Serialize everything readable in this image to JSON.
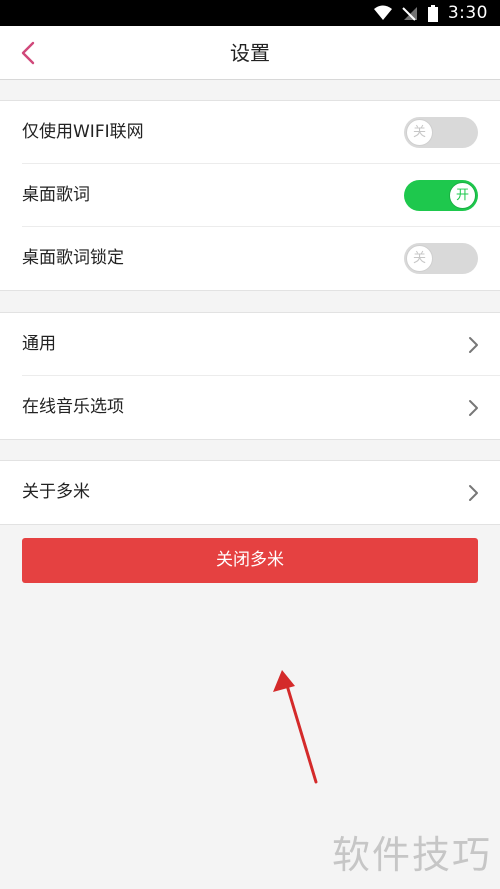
{
  "status_bar": {
    "time": "3:30",
    "icons": [
      "wifi-icon",
      "no-signal-icon",
      "battery-icon"
    ]
  },
  "nav": {
    "title": "设置",
    "back_icon": "chevron-left-icon"
  },
  "groups": [
    {
      "rows": [
        {
          "label": "仅使用WIFI联网",
          "type": "toggle",
          "state": "off",
          "toggle_text": "关"
        },
        {
          "label": "桌面歌词",
          "type": "toggle",
          "state": "on",
          "toggle_text": "开"
        },
        {
          "label": "桌面歌词锁定",
          "type": "toggle",
          "state": "off",
          "toggle_text": "关"
        }
      ]
    },
    {
      "rows": [
        {
          "label": "通用",
          "type": "link"
        },
        {
          "label": "在线音乐选项",
          "type": "link"
        }
      ]
    },
    {
      "rows": [
        {
          "label": "关于多米",
          "type": "link"
        }
      ]
    }
  ],
  "close_button": {
    "label": "关闭多米"
  },
  "watermark": "软件技巧",
  "colors": {
    "accent": "#e54141",
    "toggle_on": "#1ec84d",
    "toggle_off": "#d9d9d9",
    "back_icon": "#d0487a",
    "annotation": "#d42a2a"
  }
}
